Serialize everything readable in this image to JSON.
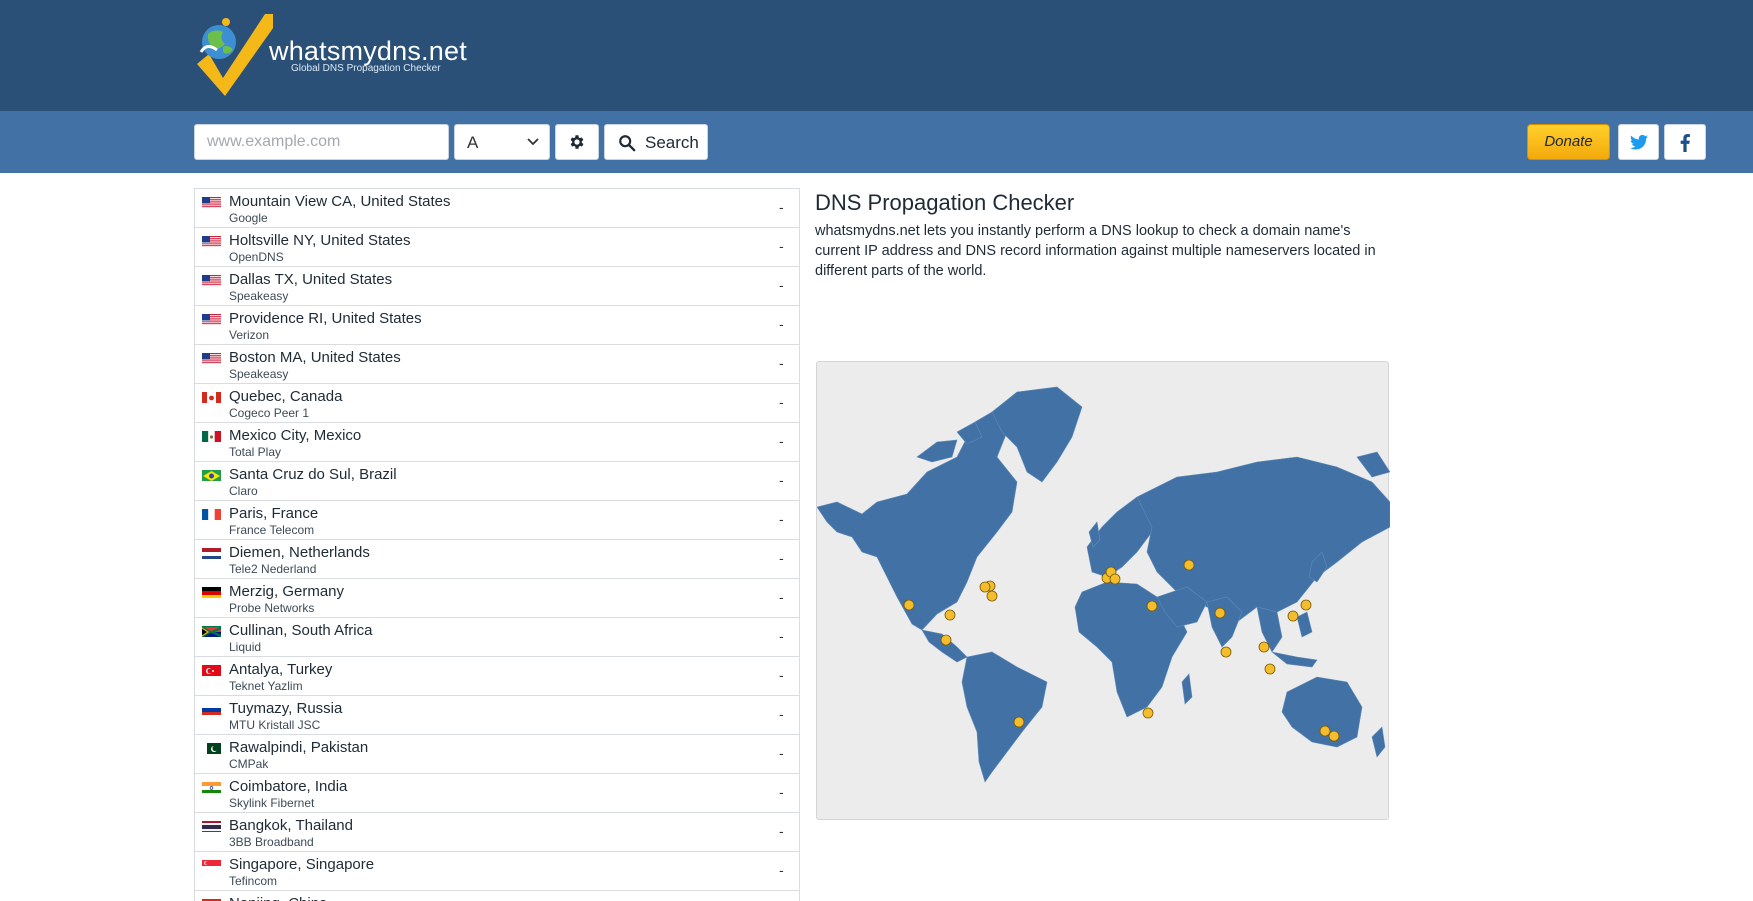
{
  "header": {
    "logo_title": "whatsmydns.net",
    "logo_tagline": "Global DNS Propagation Checker",
    "bg_color": "#2a5078"
  },
  "toolbar": {
    "bg_color": "#4272a5",
    "search_placeholder": "www.example.com",
    "search_value": "",
    "record_type": "A",
    "search_label": "Search",
    "donate_label": "Donate",
    "icons": [
      "gear-icon",
      "search-icon",
      "twitter-icon",
      "facebook-icon",
      "chevron-down-icon"
    ]
  },
  "results": [
    {
      "flag": "us",
      "location": "Mountain View CA, United States",
      "provider": "Google",
      "result": "-"
    },
    {
      "flag": "us",
      "location": "Holtsville NY, United States",
      "provider": "OpenDNS",
      "result": "-"
    },
    {
      "flag": "us",
      "location": "Dallas TX, United States",
      "provider": "Speakeasy",
      "result": "-"
    },
    {
      "flag": "us",
      "location": "Providence RI, United States",
      "provider": "Verizon",
      "result": "-"
    },
    {
      "flag": "us",
      "location": "Boston MA, United States",
      "provider": "Speakeasy",
      "result": "-"
    },
    {
      "flag": "ca",
      "location": "Quebec, Canada",
      "provider": "Cogeco Peer 1",
      "result": "-"
    },
    {
      "flag": "mx",
      "location": "Mexico City, Mexico",
      "provider": "Total Play",
      "result": "-"
    },
    {
      "flag": "br",
      "location": "Santa Cruz do Sul, Brazil",
      "provider": "Claro",
      "result": "-"
    },
    {
      "flag": "fr",
      "location": "Paris, France",
      "provider": "France Telecom",
      "result": "-"
    },
    {
      "flag": "nl",
      "location": "Diemen, Netherlands",
      "provider": "Tele2 Nederland",
      "result": "-"
    },
    {
      "flag": "de",
      "location": "Merzig, Germany",
      "provider": "Probe Networks",
      "result": "-"
    },
    {
      "flag": "za",
      "location": "Cullinan, South Africa",
      "provider": "Liquid",
      "result": "-"
    },
    {
      "flag": "tr",
      "location": "Antalya, Turkey",
      "provider": "Teknet Yazlim",
      "result": "-"
    },
    {
      "flag": "ru",
      "location": "Tuymazy, Russia",
      "provider": "MTU Kristall JSC",
      "result": "-"
    },
    {
      "flag": "pk",
      "location": "Rawalpindi, Pakistan",
      "provider": "CMPak",
      "result": "-"
    },
    {
      "flag": "in",
      "location": "Coimbatore, India",
      "provider": "Skylink Fibernet",
      "result": "-"
    },
    {
      "flag": "th",
      "location": "Bangkok, Thailand",
      "provider": "3BB Broadband",
      "result": "-"
    },
    {
      "flag": "sg",
      "location": "Singapore, Singapore",
      "provider": "Tefincom",
      "result": "-"
    },
    {
      "flag": "cn",
      "location": "Nanjing, China",
      "provider": "",
      "result": "-"
    }
  ],
  "info": {
    "title": "DNS Propagation Checker",
    "description": "whatsmydns.net lets you instantly perform a DNS lookup to check a domain name's current IP address and DNS record information against multiple nameservers located in different parts of the world."
  },
  "map": {
    "land_color": "#4272a5",
    "marker_color": "#f4bd2e",
    "background_color": "#ececec"
  }
}
